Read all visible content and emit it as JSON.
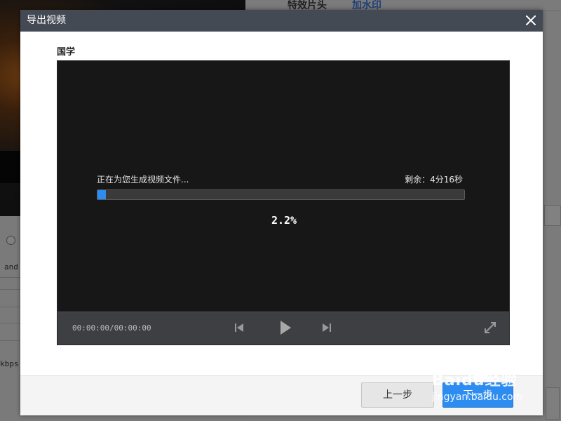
{
  "background": {
    "tabs": [
      "特效片头",
      "加水印"
    ],
    "left_snippets": [
      "and",
      "kbps"
    ]
  },
  "dialog": {
    "title": "导出视频",
    "close_icon": "close-icon",
    "video_name": "国学",
    "status_text": "正在为您生成视频文件...",
    "remaining_text": "剩余：4分16秒",
    "progress_percent": 2.2,
    "percent_label": "2.2%",
    "timecode": "00:00:00/00:00:00",
    "controls": [
      "previous-icon",
      "play-icon",
      "next-icon",
      "fullscreen-icon"
    ],
    "buttons": {
      "back": "上一步",
      "next": "下一步"
    }
  },
  "watermark": {
    "logo_text": "Baidu经验",
    "url_text": "jingyan.baidu.com"
  },
  "colors": {
    "header_bg": "#444a54",
    "player_bg": "#171717",
    "accent": "#2d8cf0"
  }
}
